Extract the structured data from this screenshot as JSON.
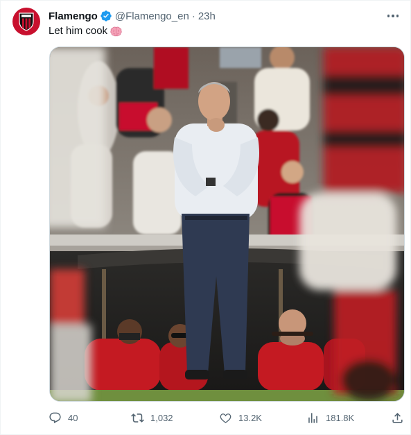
{
  "tweet": {
    "display_name": "Flamengo",
    "handle": "@Flamengo_en",
    "separator": "·",
    "time": "23h",
    "text": "Let him cook",
    "verified": true,
    "accent_color": "#1d9bf0",
    "brand_color": "#c8102e"
  },
  "actions": {
    "replies": "40",
    "retweets": "1,032",
    "likes": "13.2K",
    "views": "181.8K"
  },
  "icons": {
    "avatar": "flamengo-crest-icon",
    "verified": "verified-badge-icon",
    "more": "more-options-icon",
    "emoji": "brain-emoji-icon",
    "reply": "reply-icon",
    "retweet": "retweet-icon",
    "like": "heart-icon",
    "views": "views-bar-chart-icon",
    "share": "share-icon"
  }
}
